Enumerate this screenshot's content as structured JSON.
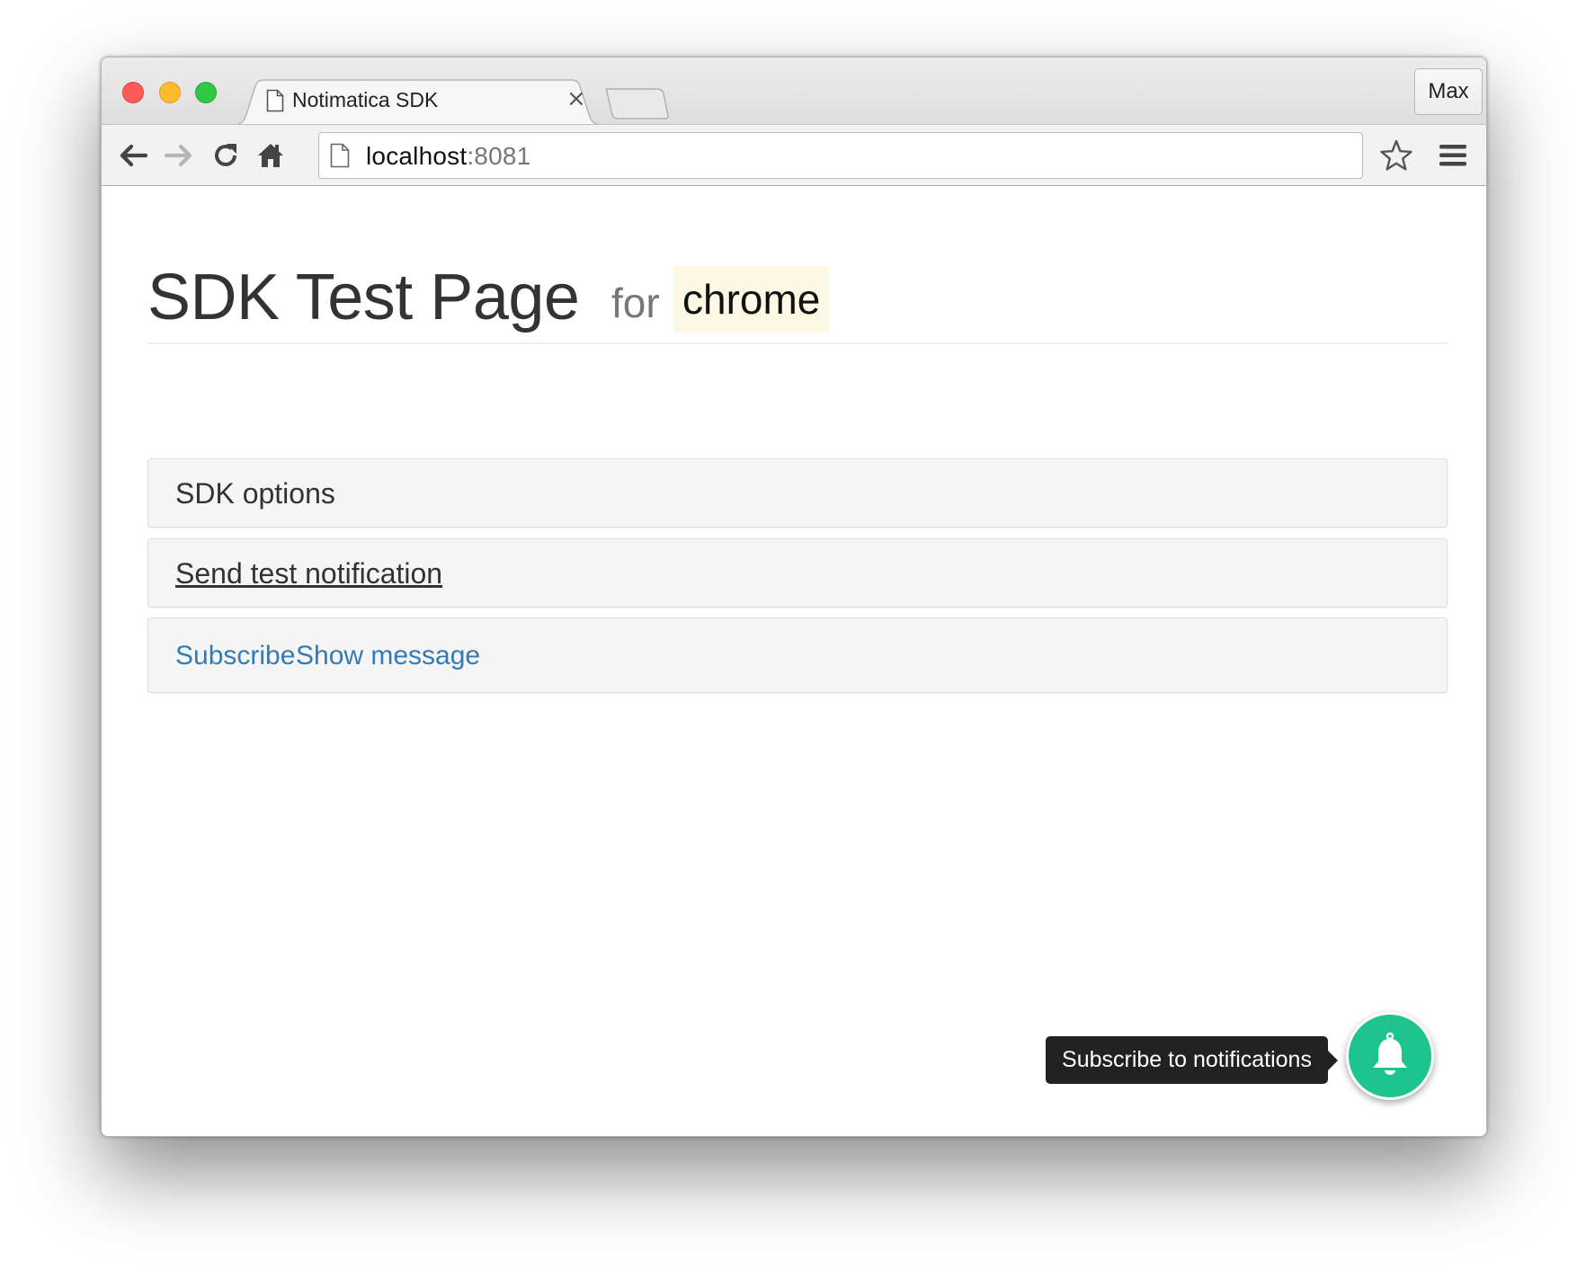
{
  "browser": {
    "tab_title": "Notimatica SDK",
    "tab_close": "×",
    "profile_label": "Max",
    "url_host": "localhost",
    "url_port": ":8081",
    "icons": [
      "back-icon",
      "forward-icon",
      "reload-icon",
      "home-icon",
      "page-icon",
      "star-icon",
      "menu-icon"
    ]
  },
  "header": {
    "title": "SDK Test Page",
    "for_text": "for",
    "browser_name": "chrome"
  },
  "panels": {
    "sdk_options": "SDK options",
    "send_test": "Send test notification",
    "subscribe_link": "Subscribe",
    "show_message_link": "Show message"
  },
  "widget": {
    "tooltip": "Subscribe to notifications",
    "bell_color": "#1dc48d",
    "icon": "bell-icon"
  },
  "colors": {
    "link": "#337ab7",
    "mark_bg": "#fcf8e3",
    "panel_bg": "#f5f5f5"
  }
}
